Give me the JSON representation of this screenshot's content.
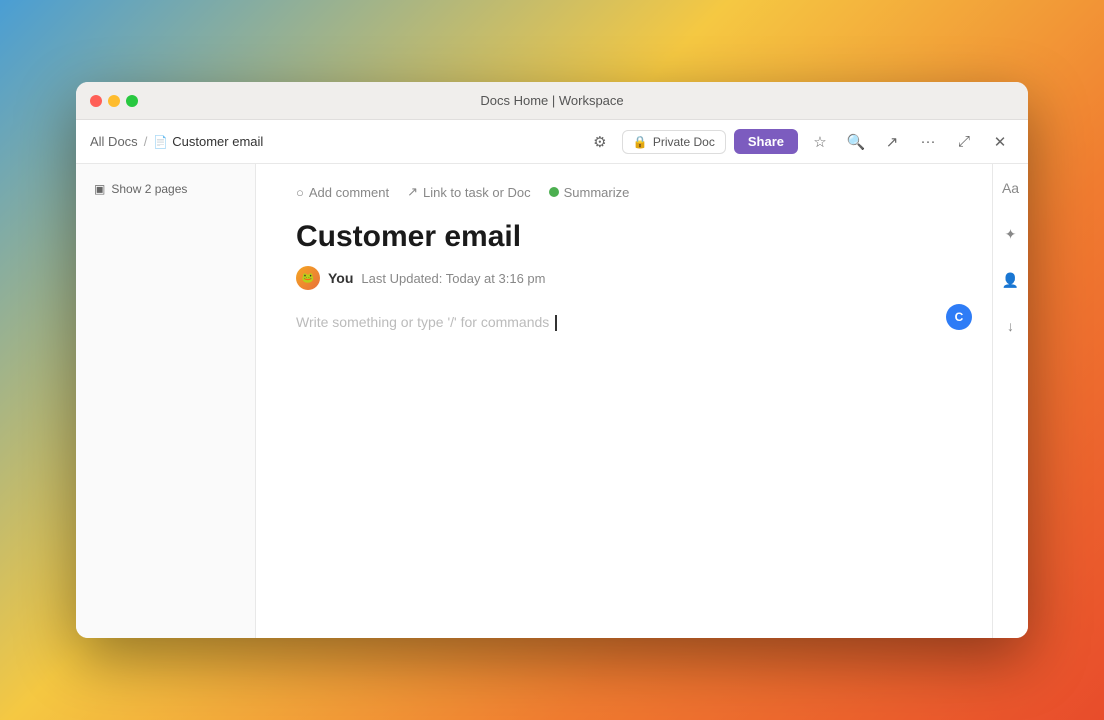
{
  "window": {
    "title": "Docs Home | Workspace"
  },
  "titlebar": {
    "title": "Docs Home | Workspace"
  },
  "breadcrumb": {
    "parent": "All Docs",
    "separator": "/",
    "current": "Customer email",
    "doc_icon": "📄"
  },
  "toolbar": {
    "private_doc_label": "Private Doc",
    "share_label": "Share",
    "lock_icon": "🔒",
    "star_icon": "☆",
    "search_icon": "🔍",
    "export_icon": "↗",
    "more_icon": "···",
    "expand_icon": "⤢",
    "close_icon": "✕",
    "settings_icon": "⚙"
  },
  "sidebar": {
    "show_pages_label": "Show 2 pages",
    "pages_icon": "▣"
  },
  "doc_toolbar": {
    "add_comment": "Add comment",
    "add_comment_icon": "○",
    "link_task": "Link to task or Doc",
    "link_icon": "↗",
    "summarize": "Summarize"
  },
  "document": {
    "title": "Customer email",
    "author": "You",
    "updated_label": "Last Updated:",
    "updated_time": "Today at 3:16 pm",
    "placeholder": "Write something or type '/' for commands"
  },
  "right_panel": {
    "font_icon": "Aa",
    "star_icon": "☆",
    "people_icon": "👤",
    "download_icon": "↓"
  }
}
